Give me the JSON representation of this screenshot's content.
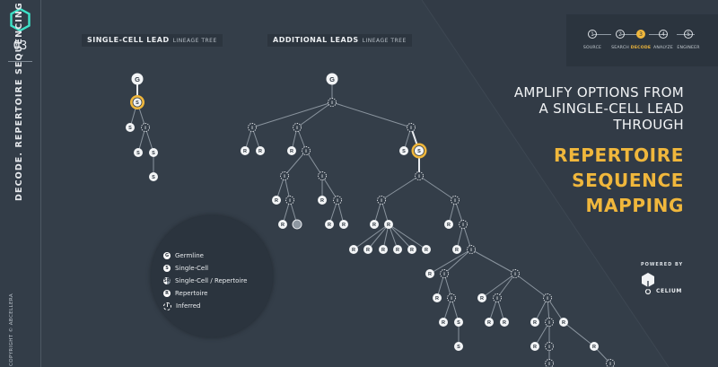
{
  "sidebar": {
    "logo_icon": "hexagon-icon",
    "section_number": "03",
    "section_title": "DECODE. REPERTOIRE SEQUENCING",
    "copyright": "COPYRIGHT © ABCELLERA"
  },
  "panels": {
    "single_cell": {
      "title": "SINGLE-CELL LEAD",
      "subtitle": "LINEAGE TREE"
    },
    "additional": {
      "title": "ADDITIONAL LEADS",
      "subtitle": "LINEAGE TREE"
    }
  },
  "node_letters": {
    "germline": "G",
    "single_cell": "S",
    "repertoire": "R",
    "inferred": "i"
  },
  "legend": {
    "items": [
      {
        "icon": "G",
        "style": "solid",
        "label": "Germline"
      },
      {
        "icon": "S",
        "style": "solid",
        "label": "Single-Cell"
      },
      {
        "icon": "SR",
        "style": "half",
        "label": "Single-Cell / Repertoire"
      },
      {
        "icon": "R",
        "style": "solid",
        "label": "Repertoire"
      },
      {
        "icon": "i",
        "style": "dash",
        "label": "Inferred"
      }
    ]
  },
  "steps": [
    {
      "n": "1",
      "label": "SOURCE",
      "active": false
    },
    {
      "n": "2",
      "label": "SEARCH",
      "active": false
    },
    {
      "n": "3",
      "label": "DECODE",
      "active": true
    },
    {
      "n": "4",
      "label": "ANALYZE",
      "active": false
    },
    {
      "n": "5",
      "label": "ENGINEER",
      "active": false
    }
  ],
  "headline": [
    "AMPLIFY OPTIONS FROM",
    "A SINGLE-CELL LEAD",
    "THROUGH"
  ],
  "headline_accent": [
    "REPERTOIRE",
    "SEQUENCE",
    "MAPPING"
  ],
  "powered_by": "POWERED BY",
  "brand": "CELIUM",
  "colors": {
    "background": "#343e49",
    "accent": "#f0b73c",
    "panel": "#2b343e",
    "text": "#f1f3f5"
  }
}
